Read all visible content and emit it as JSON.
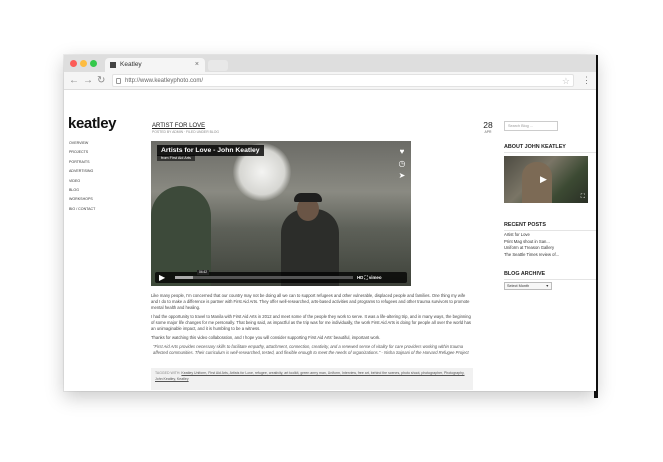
{
  "browser": {
    "tab_title": "Keatley",
    "url": "http://www.keatleyphoto.com/",
    "nav": {
      "back": "←",
      "forward": "→",
      "reload": "↻"
    },
    "colors": {
      "close": "#fc5c57",
      "minimize": "#fdbc40",
      "maximize": "#34c84a"
    }
  },
  "site": {
    "logo": "keatley",
    "nav": [
      "Overview",
      "Projects",
      "Portraits",
      "Advertising",
      "Video",
      "Blog",
      "Workshops",
      "Bio / Contact"
    ]
  },
  "post": {
    "title": "ARTIST FOR LOVE",
    "byline": "POSTED BY ADMIN · FILED UNDER BLOG",
    "day": "28",
    "month": "APR",
    "video": {
      "title": "Artists for Love - John Keatley",
      "subtitle": "from First Aid Arts",
      "time": "04:42",
      "badges": "HD ⛶ vimeo",
      "progress": 0.1
    },
    "paragraphs": [
      "Like many people, I'm concerned that our country may not be doing all we can to support refugees and other vulnerable, displaced people and families. One thing my wife and I do to make a difference is partner with First Aid Arts. They offer well-researched, arts-based activities and programs to refugees and other trauma survivors to promote mental health and healing.",
      "I had the opportunity to travel to Manila with First Aid Arts in 2012 and meet some of the people they work to serve. It was a life-altering trip, and in many ways, the beginning of some major life changes for me personally. That being said, as impactful as the trip was for me individually, the work First Aid Arts is doing for people all over the world has an unimaginable impact, and it is humbling to be a witness.",
      "Thanks for watching this video collaboration, and I hope you will consider supporting First Aid Arts' beautiful, important work."
    ],
    "quote": "\"First Aid Arts provides necessary skills to facilitate empathy, attachment, connection, creativity, and a renewed sense of vitality for care providers working within trauma affected communities. Their curriculum is well-researched, tested, and flexible enough to meet the needs of organizations.\" - Nisha Sajnani of the Harvard Refugee Project",
    "tags_label": "TAGGED WITH:",
    "tags": "Keatley Uniform, First Aid Arts, Artists for Love, refugee, creativity, art toolkit, green army man, Uniform, Interview, free art, behind the scenes, photo shoot, photographer, Photography, John Keatley, Keatley"
  },
  "sidebar": {
    "search_placeholder": "Search Blog ...",
    "about_heading": "ABOUT JOHN KEATLEY",
    "recent_heading": "RECENT POSTS",
    "recent_posts": [
      "Artist for Love",
      "Print Mag shout in San...",
      "Uniform at Treason Gallery",
      "The Seattle Times review of..."
    ],
    "archive_heading": "BLOG ARCHIVE",
    "archive_select": "Select Month"
  }
}
